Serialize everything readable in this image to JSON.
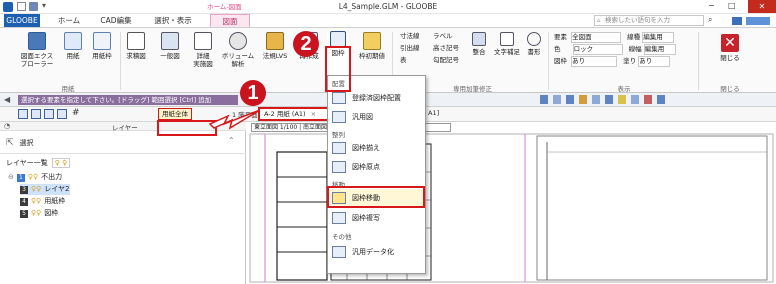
{
  "window": {
    "title": "L4_Sample.GLM - GLOOBE",
    "minimize": "−",
    "maximize": "□",
    "close": "✕"
  },
  "context_tab": {
    "group": "ホーム-図面",
    "label": "図面"
  },
  "tabs": [
    "GLOOBE",
    "ホーム",
    "CAD編集",
    "選択・表示"
  ],
  "search": {
    "placeholder": "検索したい語句を入力"
  },
  "ribbon": {
    "paper": {
      "buttons": [
        "図面エクス\nプローラー",
        "用紙",
        "用紙枠"
      ],
      "group": "用紙"
    },
    "draw": {
      "buttons": [
        "求積図",
        "一般図",
        "詳細\n実施図",
        "ボリューム\n解析",
        "法規LVS",
        "再作成",
        "図枠",
        "枠初期値"
      ]
    },
    "annotation": {
      "items": [
        "寸法線",
        "ラベル",
        "引出線",
        "高さ記号",
        "表",
        "勾配記号",
        "整合",
        "文字補足",
        "書形"
      ],
      "group": "専用加筆修正"
    },
    "display": {
      "rows": [
        [
          "要素",
          "全図面",
          "線種",
          "編集用"
        ],
        [
          "色",
          "ロック",
          "線幅",
          "編集用"
        ],
        [
          "図枠",
          "あり",
          "塗り",
          "あり"
        ]
      ],
      "group": "表示"
    },
    "close": {
      "label": "閉じる",
      "group": "閉じる"
    }
  },
  "cmdbar": {
    "text": "選択する要素を指定して下さい。[ドラッグ] 範囲選択 [Ctrl] 追加"
  },
  "doc_tabs": {
    "filter": "用紙全体",
    "tab1": "1 階平面",
    "tab2": "A-2 用紙 (A1)",
    "tab3": "A1]",
    "drawing_caption": "東立面図 1/100 | 南立面図"
  },
  "left_pane": {
    "select_label": "選択",
    "layer_list_label": "レイヤー一覧",
    "layer_toolbar_label": "レイヤー",
    "layers": [
      {
        "num": "1",
        "name": "不出力"
      },
      {
        "num": "3",
        "name": "レイヤ2"
      },
      {
        "num": "4",
        "name": "用紙枠"
      },
      {
        "num": "5",
        "name": "図枠"
      }
    ]
  },
  "menu": {
    "section_draw": "配置",
    "items_draw": [
      "登録済図枠配置",
      "汎用図"
    ],
    "section_arrange": "整列",
    "items_arrange": [
      "図枠揃え",
      "図枠原点"
    ],
    "section_edit": "移動",
    "items_edit": [
      "図枠移動",
      "図枠複写"
    ],
    "section_other": "その他",
    "items_other": [
      "汎用データ化"
    ]
  },
  "badges": {
    "step1": "1",
    "step2": "2"
  },
  "colors": {
    "accent": "#2b5fa8",
    "highlight": "#d8191c",
    "context_tab": "#e04b8a",
    "active_file_tab": "#2b5fa8"
  }
}
